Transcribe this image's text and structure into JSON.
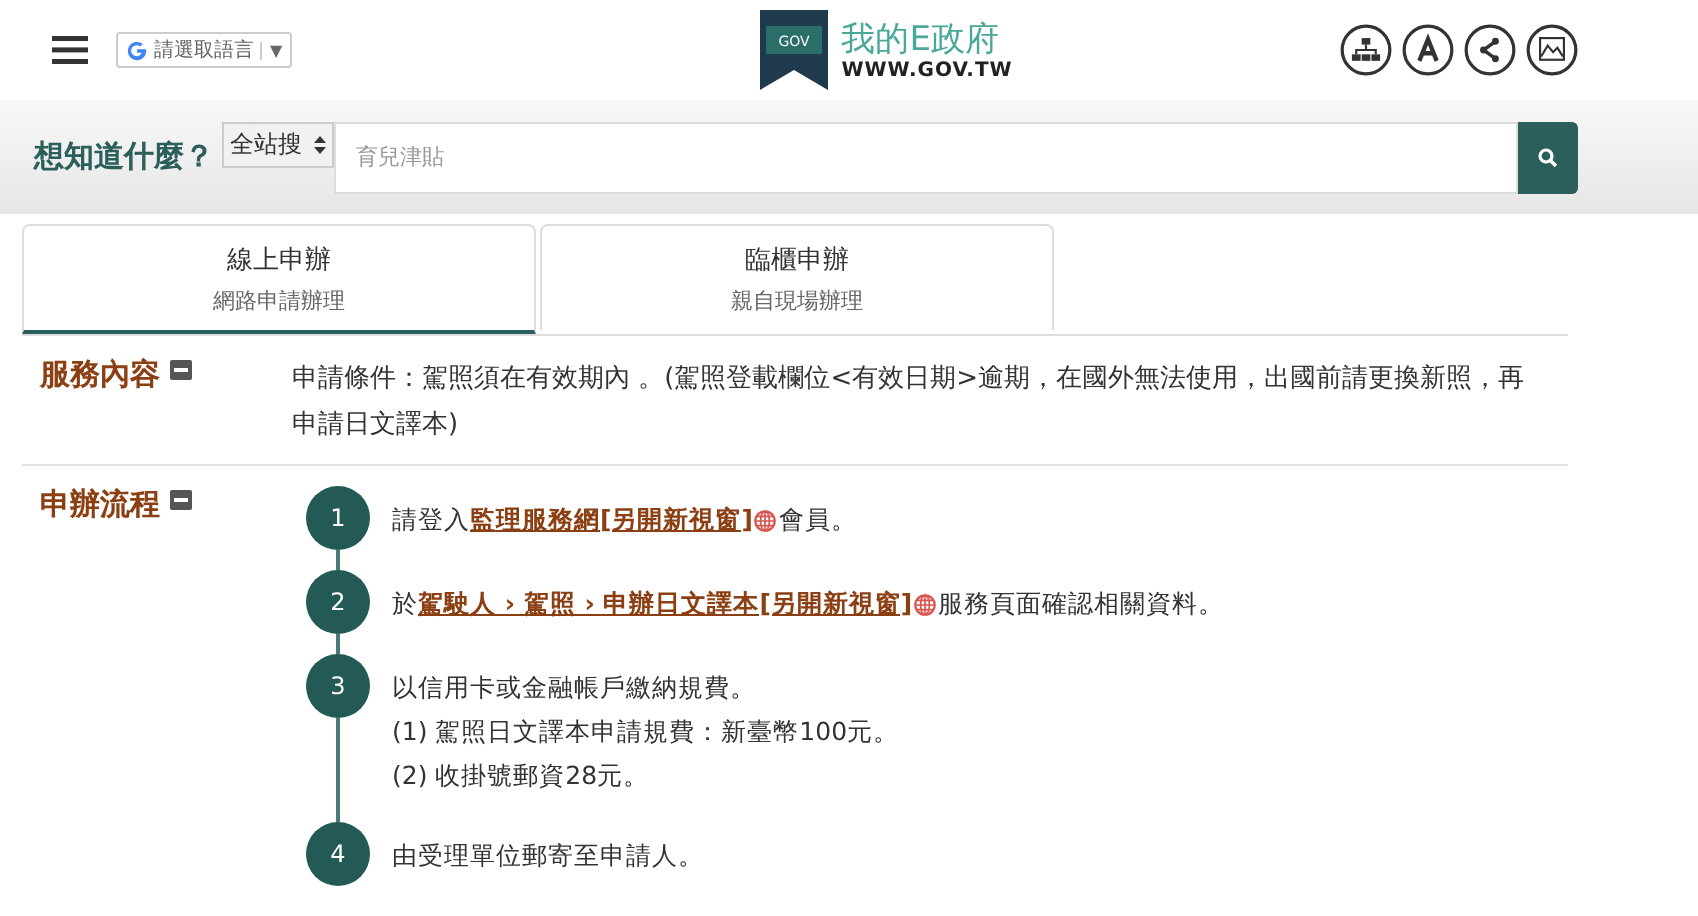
{
  "header": {
    "language_button": "請選取語言",
    "language_caret": "▼",
    "site_name": "我的E政府",
    "site_url": "WWW.GOV.TW",
    "logo_text": "GOV"
  },
  "search": {
    "label": "想知道什麼？",
    "scope": "全站搜",
    "placeholder": "育兒津貼"
  },
  "tabs": [
    {
      "title": "線上申辦",
      "subtitle": "網路申請辦理",
      "selected": true
    },
    {
      "title": "臨櫃申辦",
      "subtitle": "親自現場辦理",
      "selected": false
    }
  ],
  "sections": [
    {
      "heading": "服務內容",
      "kind": "text",
      "text": "申請條件：駕照須在有效期內 。(駕照登載欄位<有效日期>逾期，在國外無法使用，出國前請更換新照，再申請日文譯本)"
    },
    {
      "heading": "申辦流程",
      "kind": "steps",
      "steps": [
        {
          "number": "1",
          "parts": [
            {
              "kind": "text",
              "text": "請登入"
            },
            {
              "kind": "link",
              "text": "監理服務網[另開新視窗]"
            },
            {
              "kind": "text",
              "text": "會員。"
            }
          ]
        },
        {
          "number": "2",
          "parts": [
            {
              "kind": "text",
              "text": "於"
            },
            {
              "kind": "link",
              "text": "駕駛人 › 駕照 › 申辦日文譯本[另開新視窗]"
            },
            {
              "kind": "text",
              "text": "服務頁面確認相關資料。"
            }
          ]
        },
        {
          "number": "3",
          "parts": [
            {
              "kind": "text",
              "text": "以信用卡或金融帳戶繳納規費。"
            }
          ],
          "lines": [
            "(1) 駕照日文譯本申請規費：新臺幣100元。",
            "(2) 收掛號郵資28元。"
          ]
        },
        {
          "number": "4",
          "parts": [
            {
              "kind": "text",
              "text": "由受理單位郵寄至申請人。"
            }
          ]
        }
      ]
    }
  ]
}
